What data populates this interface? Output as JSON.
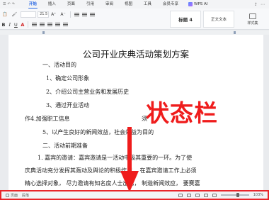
{
  "menu": {
    "tabs": [
      "开始",
      "插入",
      "页面",
      "引用",
      "审阅",
      "视图",
      "工具",
      "会员专享"
    ],
    "active_tab": "开始",
    "wps_ai": "WPS AI"
  },
  "toolbar": {
    "font_size": "21.5",
    "styles": [
      "标题 4",
      "正文文本"
    ],
    "style_set_label": "样式集"
  },
  "document": {
    "title": "公司开业庆典活动策划方案",
    "lines": [
      "一、活动目的",
      "1、确定公司形象",
      "2、介绍公司主营业务和发展历史",
      "3、通过开业活动",
      "作4.加强职工信息",
      "5、以产生良好的新闻效益，社会效益为目的",
      "二、活动前期准备",
      "1. 嘉宾的邀请：嘉宾邀请是一活动中极其重要的一环。为了使",
      "庆典活动充分发挥其轰动及舆论的积极作用，   在嘉宾邀请工作上必须",
      "精心选择对象，   尽力邀请有知名度人士出席，   制造新闻效应，   要赛嘉"
    ],
    "partial_right_1": "须",
    "overlay_label": "状态栏"
  },
  "status_bar": {
    "items": [
      "页面",
      "段落"
    ],
    "zoom": "103%"
  },
  "colors": {
    "accent": "#2d6ae3",
    "annotation": "#ef1c1c"
  }
}
